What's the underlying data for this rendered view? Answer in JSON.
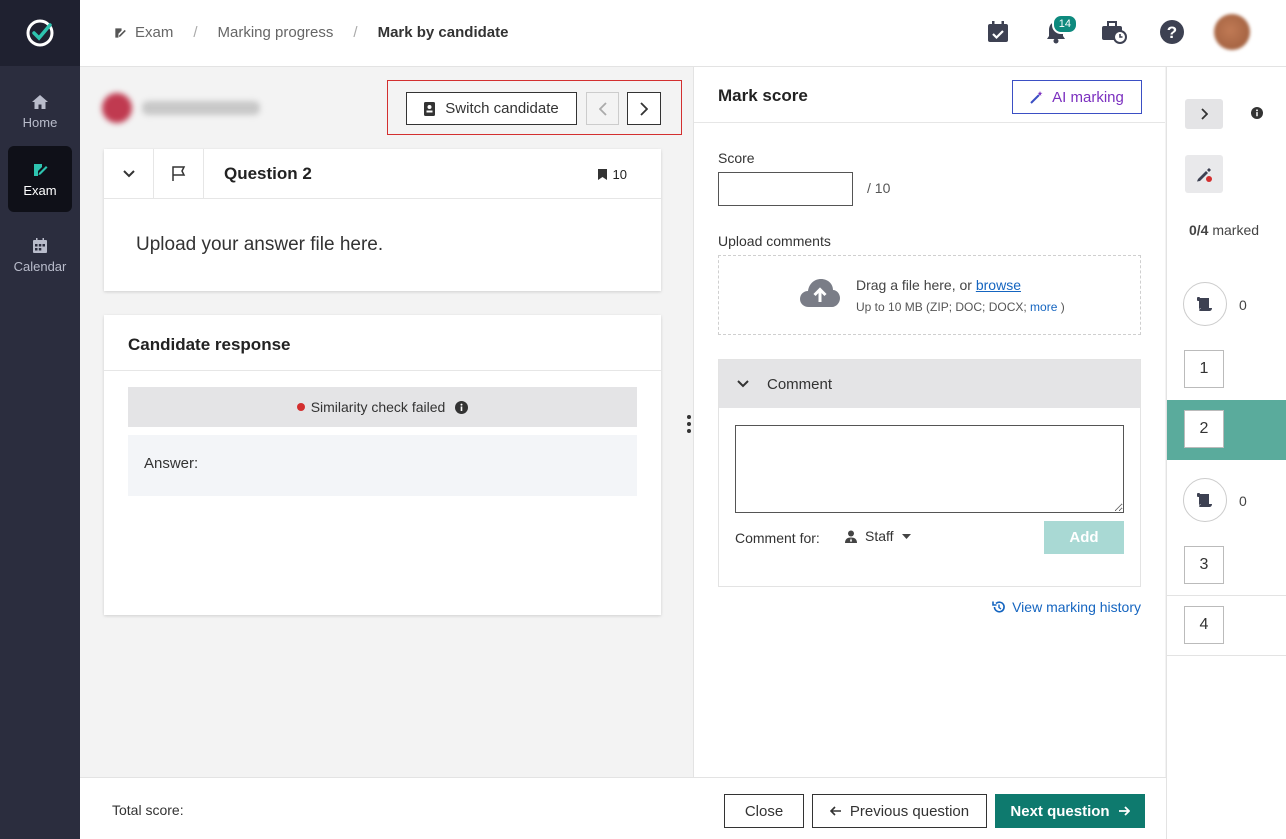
{
  "sidebar": {
    "items": [
      {
        "label": "Home",
        "icon": "home-icon"
      },
      {
        "label": "Exam",
        "icon": "exam-icon",
        "active": true
      },
      {
        "label": "Calendar",
        "icon": "calendar-icon"
      }
    ]
  },
  "header": {
    "breadcrumb": [
      "Exam",
      "Marking progress",
      "Mark by candidate"
    ],
    "notifications_count": "14"
  },
  "candidate": {
    "switch_label": "Switch candidate"
  },
  "question": {
    "title": "Question 2",
    "points": "10",
    "body": "Upload your answer file here."
  },
  "response": {
    "title": "Candidate response",
    "similarity": "Similarity check failed",
    "answer_label": "Answer:"
  },
  "mark": {
    "title": "Mark score",
    "ai_label": "AI marking",
    "score_label": "Score",
    "score_value": "",
    "score_max": "/ 10",
    "upload_label": "Upload comments",
    "upload_text": "Drag a file here, or ",
    "upload_link": "browse",
    "upload_sub": "Up to 10 MB (ZIP; DOC; DOCX; ",
    "upload_more": "more",
    "upload_sub_end": ")",
    "comment_label": "Comment",
    "comment_for_label": "Comment for:",
    "comment_for_value": "Staff",
    "add_label": "Add",
    "history_label": "View marking history"
  },
  "qnav": {
    "marked_count": "0/4",
    "marked_label": " marked",
    "group1_count": "0",
    "group2_count": "0",
    "questions": [
      "1",
      "2",
      "3",
      "4"
    ],
    "active_question": "2"
  },
  "footer": {
    "total_label": "Total score:",
    "close_label": "Close",
    "prev_label": "Previous question",
    "next_label": "Next question"
  },
  "colors": {
    "sidebar": "#2b2d3e",
    "primary": "#0e7a6e",
    "active_row": "#5aab9c",
    "link": "#1565c0"
  }
}
